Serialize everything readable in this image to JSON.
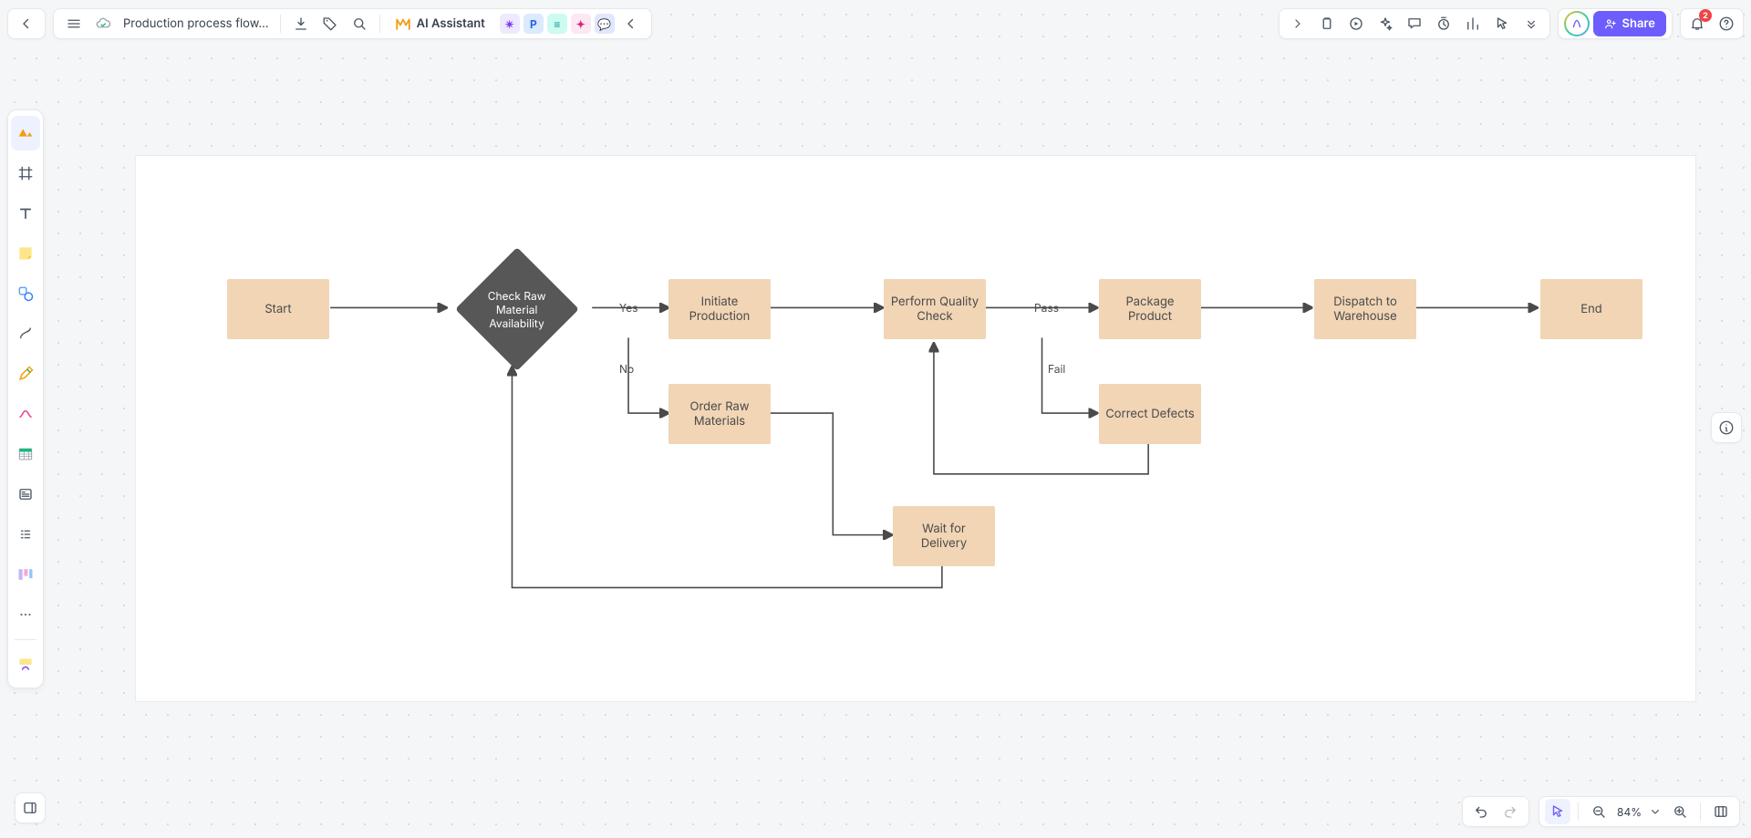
{
  "header": {
    "document_title": "Production process flow…",
    "ai_label": "AI Assistant",
    "share_label": "Share",
    "notification_count": "2",
    "zoom_label": "84%"
  },
  "collab_chips": [
    "✴",
    "P",
    "≡",
    "✦",
    "💬"
  ],
  "nodes": {
    "start": "Start",
    "check": "Check Raw Material Availability",
    "initiate": "Initiate Production",
    "quality": "Perform Quality Check",
    "pack": "Package Product",
    "dispatch": "Dispatch to Warehouse",
    "end": "End",
    "order": "Order Raw Materials",
    "wait": "Wait for Delivery",
    "correct": "Correct Defects"
  },
  "edges": {
    "yes": "Yes",
    "no": "No",
    "pass": "Pass",
    "fail": "Fail"
  },
  "chart_data": {
    "type": "flowchart",
    "title": "Production process flowchart",
    "nodes": [
      {
        "id": "start",
        "label": "Start",
        "shape": "rect"
      },
      {
        "id": "check",
        "label": "Check Raw Material Availability",
        "shape": "diamond"
      },
      {
        "id": "initiate",
        "label": "Initiate Production",
        "shape": "rect"
      },
      {
        "id": "quality",
        "label": "Perform Quality Check",
        "shape": "rect"
      },
      {
        "id": "pack",
        "label": "Package Product",
        "shape": "rect"
      },
      {
        "id": "dispatch",
        "label": "Dispatch to Warehouse",
        "shape": "rect"
      },
      {
        "id": "end",
        "label": "End",
        "shape": "rect"
      },
      {
        "id": "order",
        "label": "Order Raw Materials",
        "shape": "rect"
      },
      {
        "id": "wait",
        "label": "Wait for Delivery",
        "shape": "rect"
      },
      {
        "id": "correct",
        "label": "Correct Defects",
        "shape": "rect"
      }
    ],
    "edges": [
      {
        "from": "start",
        "to": "check"
      },
      {
        "from": "check",
        "to": "initiate",
        "label": "Yes"
      },
      {
        "from": "check",
        "to": "order",
        "label": "No"
      },
      {
        "from": "initiate",
        "to": "quality"
      },
      {
        "from": "quality",
        "to": "pack",
        "label": "Pass"
      },
      {
        "from": "quality",
        "to": "correct",
        "label": "Fail"
      },
      {
        "from": "pack",
        "to": "dispatch"
      },
      {
        "from": "dispatch",
        "to": "end"
      },
      {
        "from": "order",
        "to": "wait"
      },
      {
        "from": "wait",
        "to": "check"
      },
      {
        "from": "correct",
        "to": "quality"
      }
    ]
  }
}
